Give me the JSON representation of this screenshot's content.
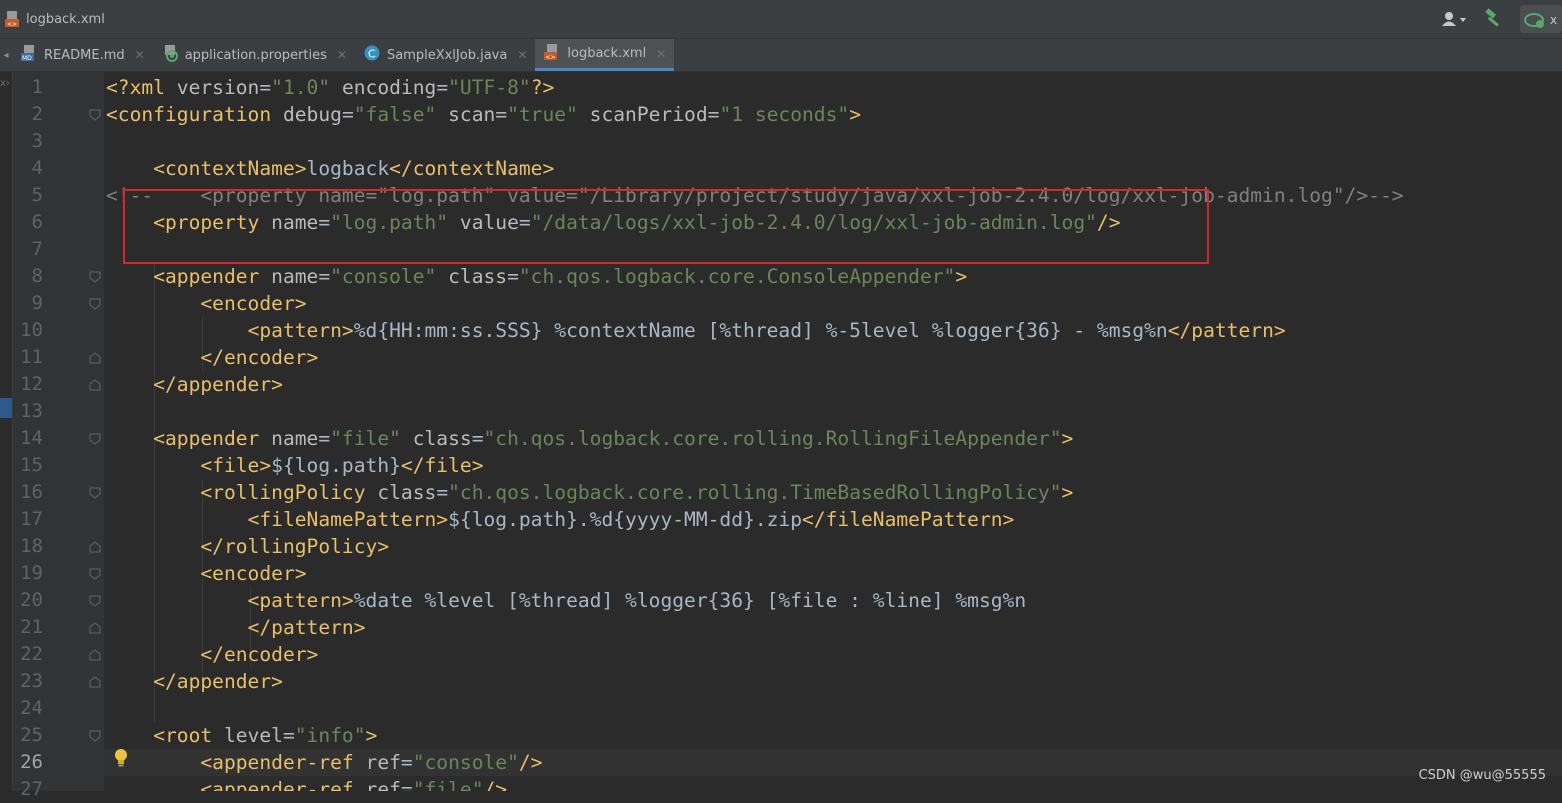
{
  "window": {
    "title": "logback.xml"
  },
  "tabs": [
    {
      "label": "README.md",
      "icon": "markdown-file-icon"
    },
    {
      "label": "application.properties",
      "icon": "properties-file-icon"
    },
    {
      "label": "SampleXxlJob.java",
      "icon": "java-class-icon"
    },
    {
      "label": "logback.xml",
      "icon": "xml-file-icon",
      "active": true
    }
  ],
  "code": {
    "current_line": 26,
    "lines": [
      {
        "n": "1",
        "tokens": [
          [
            "t",
            "<?xml "
          ],
          [
            "a",
            "version"
          ],
          [
            "p",
            "="
          ],
          [
            "v",
            "\"1.0\""
          ],
          [
            "p",
            " "
          ],
          [
            "a",
            "encoding"
          ],
          [
            "p",
            "="
          ],
          [
            "v",
            "\"UTF-8\""
          ],
          [
            "t",
            "?>"
          ]
        ]
      },
      {
        "n": "2",
        "tokens": [
          [
            "t",
            "<configuration "
          ],
          [
            "a",
            "debug"
          ],
          [
            "p",
            "="
          ],
          [
            "v",
            "\"false\""
          ],
          [
            "p",
            " "
          ],
          [
            "a",
            "scan"
          ],
          [
            "p",
            "="
          ],
          [
            "v",
            "\"true\""
          ],
          [
            "p",
            " "
          ],
          [
            "a",
            "scanPeriod"
          ],
          [
            "p",
            "="
          ],
          [
            "v",
            "\"1 seconds\""
          ],
          [
            "t",
            ">"
          ]
        ]
      },
      {
        "n": "3",
        "tokens": []
      },
      {
        "n": "4",
        "tokens": [
          [
            "p",
            "    "
          ],
          [
            "t",
            "<contextName>"
          ],
          [
            "p",
            "logback"
          ],
          [
            "t",
            "</contextName>"
          ]
        ]
      },
      {
        "n": "5",
        "tokens": [
          [
            "c",
            "<!--    <property name=\"log.path\" value=\"/Library/project/study/java/xxl-job-2.4.0/log/xxl-job-admin.log\"/>-->"
          ]
        ]
      },
      {
        "n": "6",
        "tokens": [
          [
            "p",
            "    "
          ],
          [
            "t",
            "<property "
          ],
          [
            "a",
            "name"
          ],
          [
            "p",
            "="
          ],
          [
            "v",
            "\"log.path\""
          ],
          [
            "p",
            " "
          ],
          [
            "a",
            "value"
          ],
          [
            "p",
            "="
          ],
          [
            "v",
            "\"/data/logs/xxl-job-2.4.0/log/xxl-job-admin.log\""
          ],
          [
            "t",
            "/>"
          ]
        ]
      },
      {
        "n": "7",
        "tokens": []
      },
      {
        "n": "8",
        "tokens": [
          [
            "p",
            "    "
          ],
          [
            "t",
            "<appender "
          ],
          [
            "a",
            "name"
          ],
          [
            "p",
            "="
          ],
          [
            "v",
            "\"console\""
          ],
          [
            "p",
            " "
          ],
          [
            "a",
            "class"
          ],
          [
            "p",
            "="
          ],
          [
            "v",
            "\"ch.qos.logback.core.ConsoleAppender\""
          ],
          [
            "t",
            ">"
          ]
        ]
      },
      {
        "n": "9",
        "tokens": [
          [
            "p",
            "        "
          ],
          [
            "t",
            "<encoder>"
          ]
        ]
      },
      {
        "n": "10",
        "tokens": [
          [
            "p",
            "            "
          ],
          [
            "t",
            "<pattern>"
          ],
          [
            "p",
            "%d{HH:mm:ss.SSS} %contextName [%thread] %-5level %logger{36} - %msg%n"
          ],
          [
            "t",
            "</pattern>"
          ]
        ]
      },
      {
        "n": "11",
        "tokens": [
          [
            "p",
            "        "
          ],
          [
            "t",
            "</encoder>"
          ]
        ]
      },
      {
        "n": "12",
        "tokens": [
          [
            "p",
            "    "
          ],
          [
            "t",
            "</appender>"
          ]
        ]
      },
      {
        "n": "13",
        "tokens": []
      },
      {
        "n": "14",
        "tokens": [
          [
            "p",
            "    "
          ],
          [
            "t",
            "<appender "
          ],
          [
            "a",
            "name"
          ],
          [
            "p",
            "="
          ],
          [
            "v",
            "\"file\""
          ],
          [
            "p",
            " "
          ],
          [
            "a",
            "class"
          ],
          [
            "p",
            "="
          ],
          [
            "v",
            "\"ch.qos.logback.core.rolling.RollingFileAppender\""
          ],
          [
            "t",
            ">"
          ]
        ]
      },
      {
        "n": "15",
        "tokens": [
          [
            "p",
            "        "
          ],
          [
            "t",
            "<file>"
          ],
          [
            "p",
            "${log.path}"
          ],
          [
            "t",
            "</file>"
          ]
        ]
      },
      {
        "n": "16",
        "tokens": [
          [
            "p",
            "        "
          ],
          [
            "t",
            "<rollingPolicy "
          ],
          [
            "a",
            "class"
          ],
          [
            "p",
            "="
          ],
          [
            "v",
            "\"ch.qos.logback.core.rolling.TimeBasedRollingPolicy\""
          ],
          [
            "t",
            ">"
          ]
        ]
      },
      {
        "n": "17",
        "tokens": [
          [
            "p",
            "            "
          ],
          [
            "t",
            "<fileNamePattern>"
          ],
          [
            "p",
            "${log.path}.%d{yyyy-MM-dd}.zip"
          ],
          [
            "t",
            "</fileNamePattern>"
          ]
        ]
      },
      {
        "n": "18",
        "tokens": [
          [
            "p",
            "        "
          ],
          [
            "t",
            "</rollingPolicy>"
          ]
        ]
      },
      {
        "n": "19",
        "tokens": [
          [
            "p",
            "        "
          ],
          [
            "t",
            "<encoder>"
          ]
        ]
      },
      {
        "n": "20",
        "tokens": [
          [
            "p",
            "            "
          ],
          [
            "t",
            "<pattern>"
          ],
          [
            "p",
            "%date %level [%thread] %logger{36} [%file : %line] %msg%n"
          ]
        ]
      },
      {
        "n": "21",
        "tokens": [
          [
            "p",
            "            "
          ],
          [
            "t",
            "</pattern>"
          ]
        ]
      },
      {
        "n": "22",
        "tokens": [
          [
            "p",
            "        "
          ],
          [
            "t",
            "</encoder>"
          ]
        ]
      },
      {
        "n": "23",
        "tokens": [
          [
            "p",
            "    "
          ],
          [
            "t",
            "</appender>"
          ]
        ]
      },
      {
        "n": "24",
        "tokens": []
      },
      {
        "n": "25",
        "tokens": [
          [
            "p",
            "    "
          ],
          [
            "t",
            "<root "
          ],
          [
            "a",
            "level"
          ],
          [
            "p",
            "="
          ],
          [
            "v",
            "\"info\""
          ],
          [
            "t",
            ">"
          ]
        ]
      },
      {
        "n": "26",
        "tokens": [
          [
            "p",
            "        "
          ],
          [
            "t",
            "<appender-ref "
          ],
          [
            "a",
            "ref"
          ],
          [
            "p",
            "="
          ],
          [
            "v",
            "\"console\""
          ],
          [
            "t",
            "/>"
          ]
        ]
      },
      {
        "n": "27",
        "tokens": [
          [
            "p",
            "        "
          ],
          [
            "t",
            "<appender-ref "
          ],
          [
            "a",
            "ref"
          ],
          [
            "p",
            "="
          ],
          [
            "v",
            "\"file\""
          ],
          [
            "t",
            "/>"
          ]
        ]
      }
    ]
  },
  "watermark": "CSDN @wu@55555",
  "colors": {
    "tag": "#e8bf6a",
    "attribute": "#bababa",
    "value": "#6a8759",
    "text": "#a9b7c6",
    "comment": "#808080",
    "highlight_box": "#d22a2a"
  }
}
